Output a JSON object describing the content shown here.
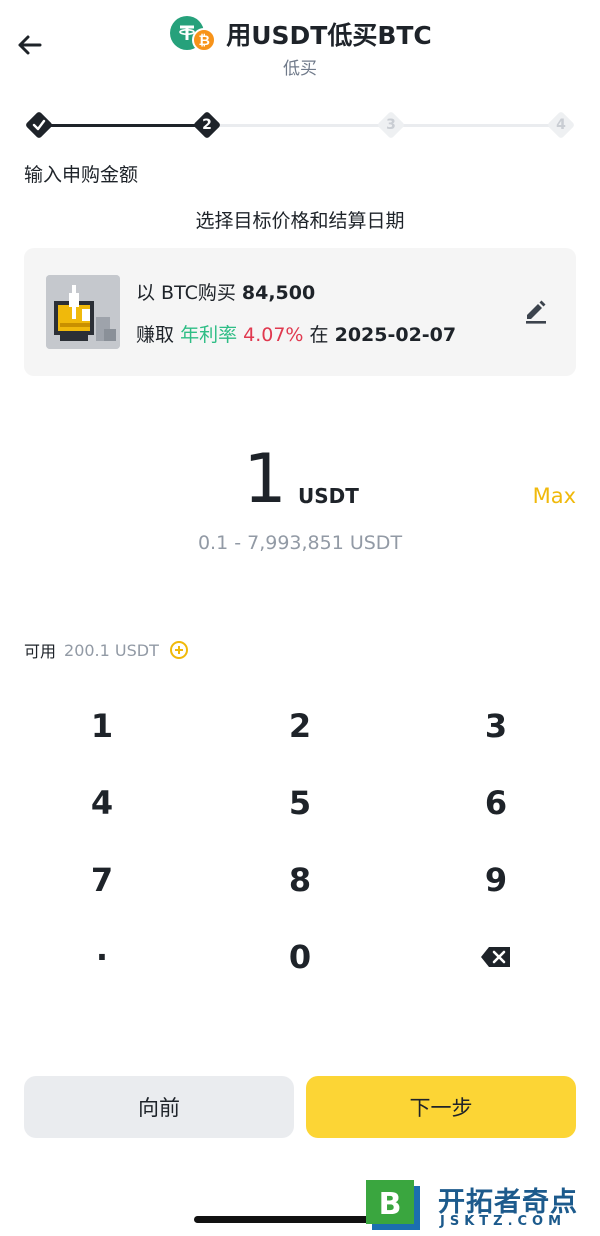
{
  "header": {
    "title": "用USDT低买BTC",
    "subtitle": "低买",
    "coin_usdt_symbol": "₮",
    "coin_btc_symbol": "₿"
  },
  "stepper": {
    "steps": [
      "1",
      "2",
      "3",
      "4"
    ],
    "current": 2
  },
  "section_label": "输入申购金额",
  "choose_label": "选择目标价格和结算日期",
  "plan": {
    "buy_prefix": "以 BTC购买",
    "buy_price": "84,500",
    "earn_label": "赚取",
    "apr_label": "年利率",
    "apr_value": "4.07%",
    "date_prefix": "在",
    "date": "2025-02-07"
  },
  "amount": {
    "value": "1",
    "unit": "USDT",
    "max_label": "Max",
    "range": "0.1 - 7,993,851 USDT"
  },
  "available": {
    "label": "可用",
    "value": "200.1 USDT"
  },
  "keypad": {
    "keys": [
      "1",
      "2",
      "3",
      "4",
      "5",
      "6",
      "7",
      "8",
      "9",
      "·",
      "0"
    ]
  },
  "buttons": {
    "prev": "向前",
    "next": "下一步"
  },
  "watermark": {
    "logo_letter": "B",
    "title": "开拓者奇点",
    "subtitle": "JSKTZ.COM"
  },
  "colors": {
    "accent_yellow": "#fcd535",
    "max_yellow": "#f0b90b",
    "apr_green": "#2ebd85",
    "apr_red": "#e0394f",
    "usdt_green": "#26a17b",
    "btc_orange": "#f7931a"
  }
}
